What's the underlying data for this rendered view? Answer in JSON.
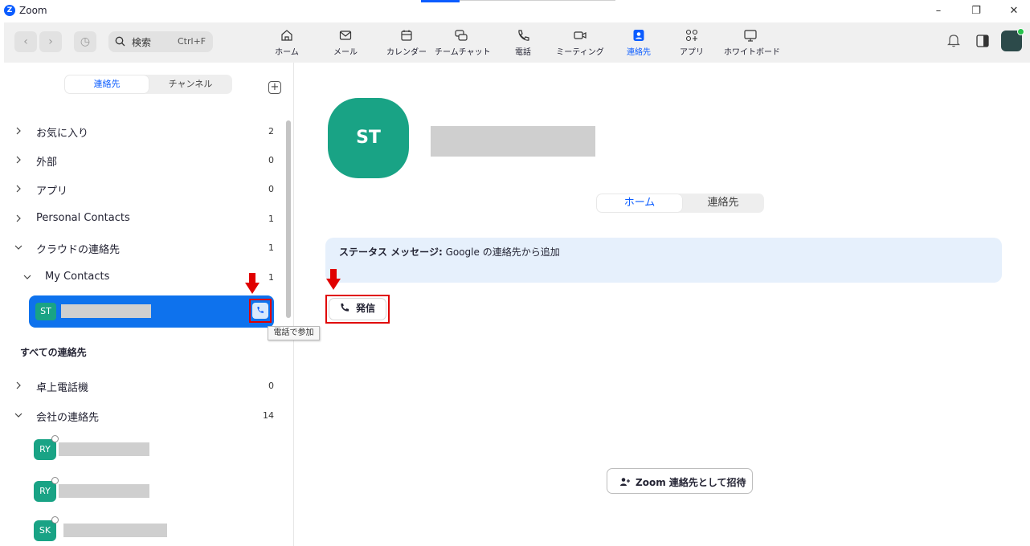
{
  "window": {
    "app_name": "Zoom",
    "logo_letter": "Z"
  },
  "toolbar": {
    "search_placeholder": "検索",
    "search_shortcut": "Ctrl+F",
    "tabs": [
      {
        "label": "ホーム",
        "icon": "home-icon"
      },
      {
        "label": "メール",
        "icon": "mail-icon"
      },
      {
        "label": "カレンダー",
        "icon": "calendar-icon"
      },
      {
        "label": "チームチャット",
        "icon": "chat-icon"
      },
      {
        "label": "電話",
        "icon": "phone-icon"
      },
      {
        "label": "ミーティング",
        "icon": "video-icon"
      },
      {
        "label": "連絡先",
        "icon": "contacts-icon",
        "active": true
      },
      {
        "label": "アプリ",
        "icon": "apps-icon"
      },
      {
        "label": "ホワイトボード",
        "icon": "whiteboard-icon"
      }
    ]
  },
  "sidebar": {
    "segments": {
      "active": "連絡先",
      "inactive": "チャンネル"
    },
    "groups": [
      {
        "label": "お気に入り",
        "count": "2"
      },
      {
        "label": "外部",
        "count": "0"
      },
      {
        "label": "アプリ",
        "count": "0"
      },
      {
        "label": "Personal Contacts",
        "count": "1"
      },
      {
        "label": "クラウドの連絡先",
        "count": "1"
      },
      {
        "label": "My Contacts",
        "count": "1"
      }
    ],
    "selected_contact": {
      "initials": "ST"
    },
    "tooltip": "電話で参加",
    "all_contacts_header": "すべての連絡先",
    "groups2": [
      {
        "label": "卓上電話機",
        "count": "0"
      },
      {
        "label": "会社の連絡先",
        "count": "14"
      }
    ],
    "contacts": [
      {
        "initials": "RY"
      },
      {
        "initials": "RY"
      },
      {
        "initials": "SK"
      }
    ]
  },
  "profile": {
    "initials": "ST",
    "tabs": {
      "active": "ホーム",
      "inactive": "連絡先"
    },
    "status_label": "ステータス メッセージ:",
    "status_text": " Google の連絡先から追加",
    "call_button": "発信",
    "invite_button": "Zoom 連絡先として招待"
  },
  "colors": {
    "accent": "#0b5cff",
    "avatar": "#19a385",
    "selected_row": "#0e72ed",
    "highlight": "#e00000"
  }
}
